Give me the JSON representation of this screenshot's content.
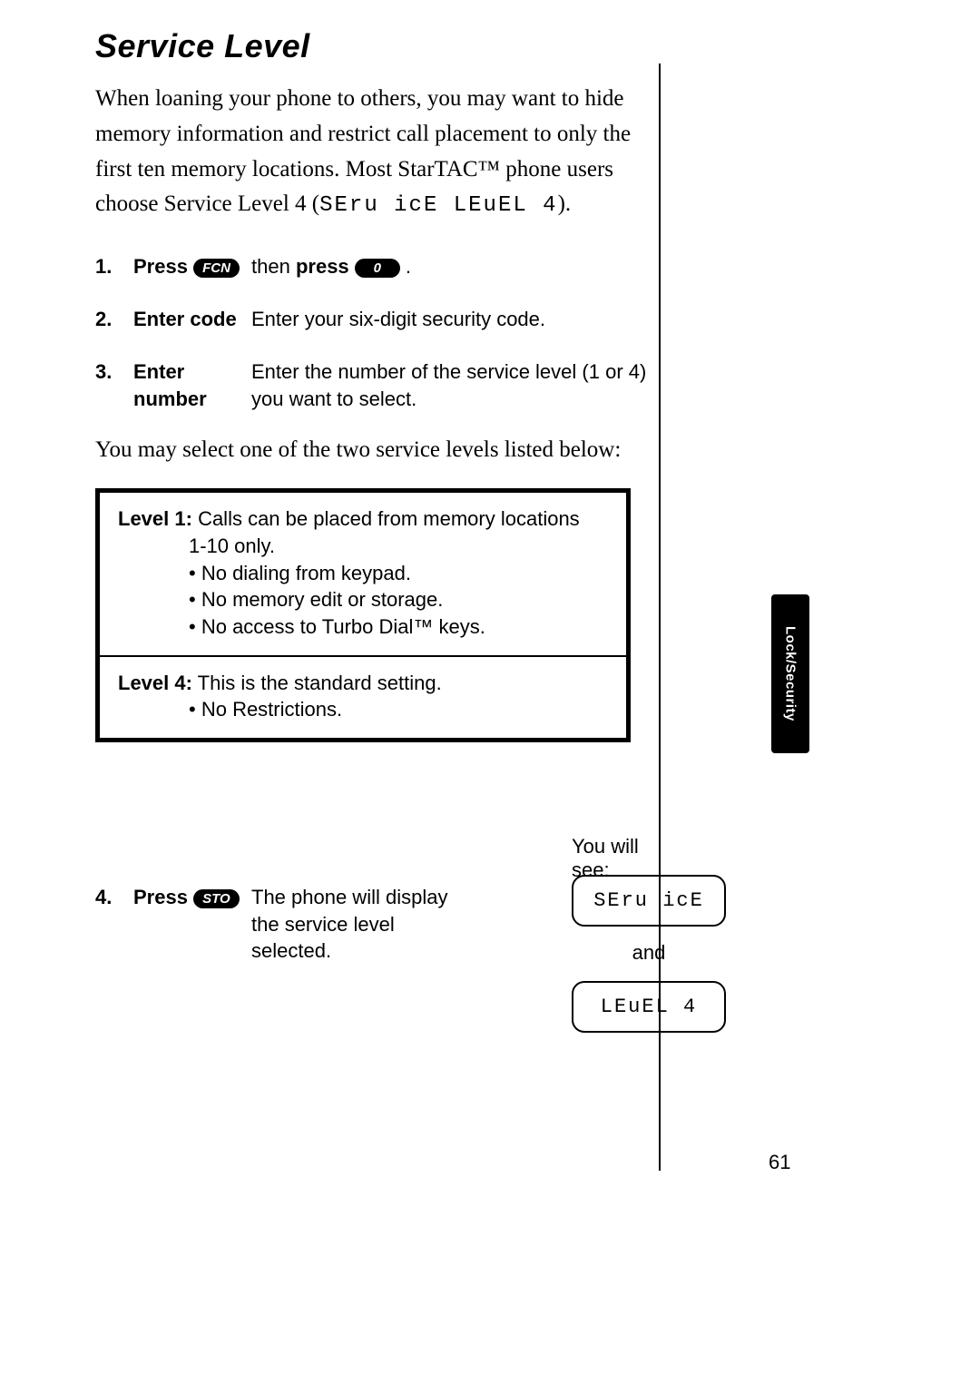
{
  "title": "Service Level",
  "intro_prefix": "When loaning your phone to others, you may want to hide memory information and restrict call placement to only the first ten memory locations. Most StarTAC™ phone users choose Service Level 4 (",
  "intro_seg": "SEru icE LEuEL  4",
  "intro_suffix": ").",
  "steps": {
    "s1": {
      "num": "1.",
      "action": "Press",
      "key1": "FCN",
      "mid": "then",
      "action2": "press",
      "key2": "0",
      "tail": "."
    },
    "s2": {
      "num": "2.",
      "action": "Enter code",
      "desc": "Enter your six-digit security code."
    },
    "s3": {
      "num": "3.",
      "action": "Enter number",
      "desc": "Enter the number of the service level (1 or 4) you want to select."
    },
    "s4": {
      "num": "4.",
      "action": "Press",
      "key": "STO",
      "desc": "The phone will display the service level selected."
    }
  },
  "between": "You may select one of the two service levels listed below:",
  "levels": {
    "l1": {
      "name": "Level 1:",
      "desc": "Calls can be placed from memory locations",
      "sub": "1-10 only.",
      "bullets": [
        "No dialing from keypad.",
        "No memory edit or storage.",
        "No access to Turbo Dial™ keys."
      ]
    },
    "l4": {
      "name": "Level 4:",
      "desc": "This is the standard setting.",
      "bullets": [
        "No Restrictions."
      ]
    }
  },
  "youwillsee": "You will see:",
  "display1": "SEru icE",
  "and": "and",
  "display2": "LEuEL  4",
  "sidetab": "Lock/Security",
  "pagenum": "61"
}
